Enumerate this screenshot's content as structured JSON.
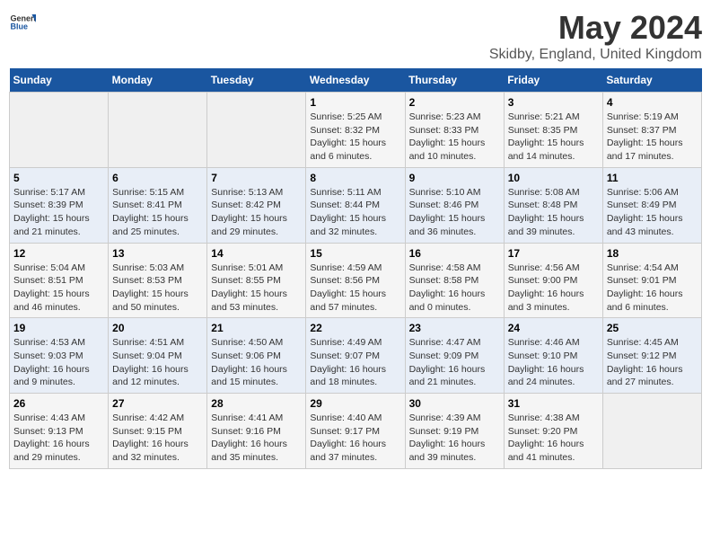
{
  "header": {
    "logo_general": "General",
    "logo_blue": "Blue",
    "title": "May 2024",
    "subtitle": "Skidby, England, United Kingdom"
  },
  "weekdays": [
    "Sunday",
    "Monday",
    "Tuesday",
    "Wednesday",
    "Thursday",
    "Friday",
    "Saturday"
  ],
  "weeks": [
    [
      {
        "day": "",
        "info": ""
      },
      {
        "day": "",
        "info": ""
      },
      {
        "day": "",
        "info": ""
      },
      {
        "day": "1",
        "info": "Sunrise: 5:25 AM\nSunset: 8:32 PM\nDaylight: 15 hours\nand 6 minutes."
      },
      {
        "day": "2",
        "info": "Sunrise: 5:23 AM\nSunset: 8:33 PM\nDaylight: 15 hours\nand 10 minutes."
      },
      {
        "day": "3",
        "info": "Sunrise: 5:21 AM\nSunset: 8:35 PM\nDaylight: 15 hours\nand 14 minutes."
      },
      {
        "day": "4",
        "info": "Sunrise: 5:19 AM\nSunset: 8:37 PM\nDaylight: 15 hours\nand 17 minutes."
      }
    ],
    [
      {
        "day": "5",
        "info": "Sunrise: 5:17 AM\nSunset: 8:39 PM\nDaylight: 15 hours\nand 21 minutes."
      },
      {
        "day": "6",
        "info": "Sunrise: 5:15 AM\nSunset: 8:41 PM\nDaylight: 15 hours\nand 25 minutes."
      },
      {
        "day": "7",
        "info": "Sunrise: 5:13 AM\nSunset: 8:42 PM\nDaylight: 15 hours\nand 29 minutes."
      },
      {
        "day": "8",
        "info": "Sunrise: 5:11 AM\nSunset: 8:44 PM\nDaylight: 15 hours\nand 32 minutes."
      },
      {
        "day": "9",
        "info": "Sunrise: 5:10 AM\nSunset: 8:46 PM\nDaylight: 15 hours\nand 36 minutes."
      },
      {
        "day": "10",
        "info": "Sunrise: 5:08 AM\nSunset: 8:48 PM\nDaylight: 15 hours\nand 39 minutes."
      },
      {
        "day": "11",
        "info": "Sunrise: 5:06 AM\nSunset: 8:49 PM\nDaylight: 15 hours\nand 43 minutes."
      }
    ],
    [
      {
        "day": "12",
        "info": "Sunrise: 5:04 AM\nSunset: 8:51 PM\nDaylight: 15 hours\nand 46 minutes."
      },
      {
        "day": "13",
        "info": "Sunrise: 5:03 AM\nSunset: 8:53 PM\nDaylight: 15 hours\nand 50 minutes."
      },
      {
        "day": "14",
        "info": "Sunrise: 5:01 AM\nSunset: 8:55 PM\nDaylight: 15 hours\nand 53 minutes."
      },
      {
        "day": "15",
        "info": "Sunrise: 4:59 AM\nSunset: 8:56 PM\nDaylight: 15 hours\nand 57 minutes."
      },
      {
        "day": "16",
        "info": "Sunrise: 4:58 AM\nSunset: 8:58 PM\nDaylight: 16 hours\nand 0 minutes."
      },
      {
        "day": "17",
        "info": "Sunrise: 4:56 AM\nSunset: 9:00 PM\nDaylight: 16 hours\nand 3 minutes."
      },
      {
        "day": "18",
        "info": "Sunrise: 4:54 AM\nSunset: 9:01 PM\nDaylight: 16 hours\nand 6 minutes."
      }
    ],
    [
      {
        "day": "19",
        "info": "Sunrise: 4:53 AM\nSunset: 9:03 PM\nDaylight: 16 hours\nand 9 minutes."
      },
      {
        "day": "20",
        "info": "Sunrise: 4:51 AM\nSunset: 9:04 PM\nDaylight: 16 hours\nand 12 minutes."
      },
      {
        "day": "21",
        "info": "Sunrise: 4:50 AM\nSunset: 9:06 PM\nDaylight: 16 hours\nand 15 minutes."
      },
      {
        "day": "22",
        "info": "Sunrise: 4:49 AM\nSunset: 9:07 PM\nDaylight: 16 hours\nand 18 minutes."
      },
      {
        "day": "23",
        "info": "Sunrise: 4:47 AM\nSunset: 9:09 PM\nDaylight: 16 hours\nand 21 minutes."
      },
      {
        "day": "24",
        "info": "Sunrise: 4:46 AM\nSunset: 9:10 PM\nDaylight: 16 hours\nand 24 minutes."
      },
      {
        "day": "25",
        "info": "Sunrise: 4:45 AM\nSunset: 9:12 PM\nDaylight: 16 hours\nand 27 minutes."
      }
    ],
    [
      {
        "day": "26",
        "info": "Sunrise: 4:43 AM\nSunset: 9:13 PM\nDaylight: 16 hours\nand 29 minutes."
      },
      {
        "day": "27",
        "info": "Sunrise: 4:42 AM\nSunset: 9:15 PM\nDaylight: 16 hours\nand 32 minutes."
      },
      {
        "day": "28",
        "info": "Sunrise: 4:41 AM\nSunset: 9:16 PM\nDaylight: 16 hours\nand 35 minutes."
      },
      {
        "day": "29",
        "info": "Sunrise: 4:40 AM\nSunset: 9:17 PM\nDaylight: 16 hours\nand 37 minutes."
      },
      {
        "day": "30",
        "info": "Sunrise: 4:39 AM\nSunset: 9:19 PM\nDaylight: 16 hours\nand 39 minutes."
      },
      {
        "day": "31",
        "info": "Sunrise: 4:38 AM\nSunset: 9:20 PM\nDaylight: 16 hours\nand 41 minutes."
      },
      {
        "day": "",
        "info": ""
      }
    ]
  ]
}
